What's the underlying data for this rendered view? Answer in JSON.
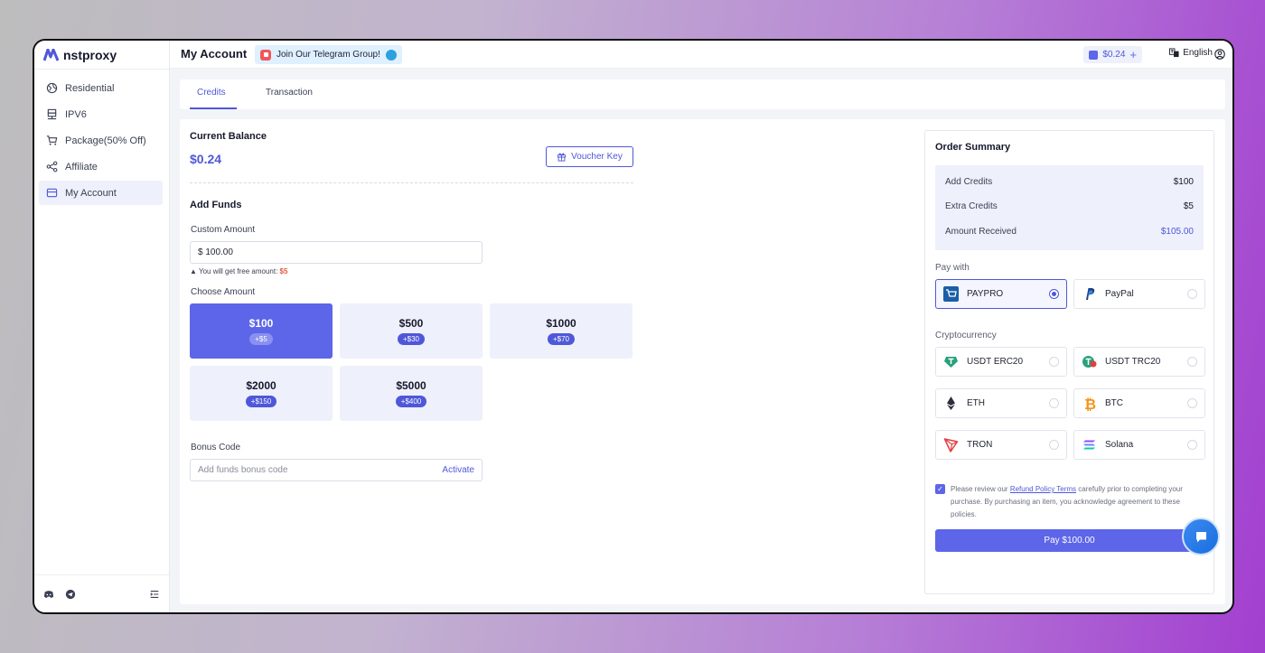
{
  "brand": {
    "name": "nstproxy"
  },
  "sidebar": {
    "items": [
      {
        "label": "Residential",
        "icon": "globe-icon"
      },
      {
        "label": "IPV6",
        "icon": "server-icon"
      },
      {
        "label": "Package(50% Off)",
        "icon": "cart-icon"
      },
      {
        "label": "Affiliate",
        "icon": "share-icon"
      },
      {
        "label": "My Account",
        "icon": "card-icon",
        "active": true
      }
    ],
    "bottom_icons": [
      "discord-icon",
      "telegram-icon",
      "collapse-icon"
    ]
  },
  "topbar": {
    "title": "My Account",
    "banner": "Join Our Telegram Group!",
    "balance": "$0.24",
    "language": "English"
  },
  "tabs": [
    {
      "label": "Credits",
      "active": true
    },
    {
      "label": "Transaction",
      "active": false
    }
  ],
  "balance": {
    "title": "Current Balance",
    "value": "$0.24",
    "voucher_label": "Voucher Key"
  },
  "funds": {
    "title": "Add Funds",
    "custom_label": "Custom Amount",
    "custom_value": "$ 100.00",
    "free_note_prefix": "You will get free amount:",
    "free_amount": "$5",
    "choose_label": "Choose Amount",
    "amounts": [
      {
        "price": "$100",
        "bonus": "+$5",
        "selected": true
      },
      {
        "price": "$500",
        "bonus": "+$30",
        "selected": false
      },
      {
        "price": "$1000",
        "bonus": "+$70",
        "selected": false
      },
      {
        "price": "$2000",
        "bonus": "+$150",
        "selected": false
      },
      {
        "price": "$5000",
        "bonus": "+$400",
        "selected": false
      }
    ],
    "bonus_label": "Bonus Code",
    "bonus_placeholder": "Add funds bonus code",
    "activate_label": "Activate"
  },
  "summary": {
    "title": "Order Summary",
    "rows": [
      {
        "label": "Add Credits",
        "value": "$100"
      },
      {
        "label": "Extra Credits",
        "value": "$5"
      },
      {
        "label": "Amount Received",
        "value": "$105.00"
      }
    ],
    "pay_with_label": "Pay with",
    "pay_methods": [
      {
        "name": "PAYPRO",
        "selected": true
      },
      {
        "name": "PayPal",
        "selected": false
      }
    ],
    "crypto_label": "Cryptocurrency",
    "crypto_methods": [
      {
        "name": "USDT ERC20"
      },
      {
        "name": "USDT TRC20"
      },
      {
        "name": "ETH"
      },
      {
        "name": "BTC"
      },
      {
        "name": "TRON"
      },
      {
        "name": "Solana"
      }
    ],
    "policy_prefix": "Please review our",
    "policy_link": "Refund Policy Terms",
    "policy_suffix": "carefully prior to completing your purchase. By purchasing an item, you acknowledge agreement to these policies.",
    "pay_button": "Pay $100.00"
  },
  "colors": {
    "accent": "#5d65e8",
    "accent_dark": "#4f57d9",
    "light_accent": "#eef0fb",
    "warn": "#e2583e"
  }
}
